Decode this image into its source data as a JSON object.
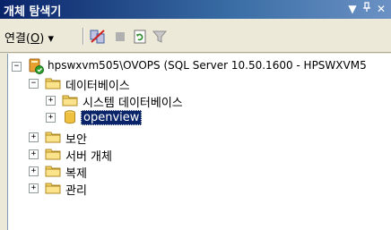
{
  "window": {
    "title": "개체 탐색기",
    "dropdown_glyph": "▼",
    "pin_glyph": "ᵖ",
    "close_glyph": "✕"
  },
  "toolbar": {
    "connect_label_prefix": "연결(",
    "connect_label_key": "O",
    "connect_label_suffix": ")",
    "connect_dropdown": "▾"
  },
  "tree": {
    "server": "hpswxvm505\\OVOPS (SQL Server 10.50.1600 - HPSWXVM5",
    "databases": "데이터베이스",
    "system_databases": "시스템 데이터베이스",
    "openview": "openview",
    "security": "보안",
    "server_objects": "서버 개체",
    "replication": "복제",
    "management": "관리",
    "expanded_glyph": "−",
    "collapsed_glyph": "+"
  }
}
